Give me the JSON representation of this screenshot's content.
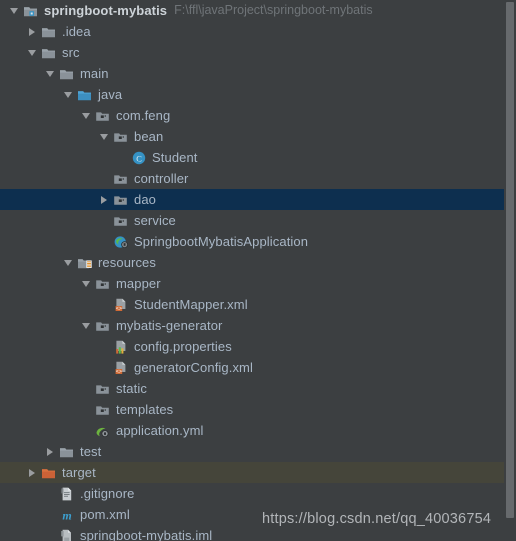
{
  "window": {
    "background": "#3c3f41",
    "selection_color": "#0d2f4f",
    "target_row_color": "#45453a",
    "text_color": "#a9b7c6"
  },
  "project": {
    "name": "springboot-mybatis",
    "path": "F:\\ffl\\javaProject\\springboot-mybatis"
  },
  "watermark": {
    "text": "https://blog.csdn.net/qq_40036754"
  },
  "tree": {
    "rows": [
      {
        "label": "springboot-mybatis",
        "suffix": "F:\\ffl\\javaProject\\springboot-mybatis",
        "indent": 0,
        "arrow": "expanded",
        "icon": "project-module-icon",
        "bold": true,
        "state": "normal"
      },
      {
        "label": ".idea",
        "indent": 1,
        "arrow": "collapsed",
        "icon": "folder-grey-icon",
        "bold": false,
        "state": "normal"
      },
      {
        "label": "src",
        "indent": 1,
        "arrow": "expanded",
        "icon": "folder-grey-icon",
        "bold": false,
        "state": "normal"
      },
      {
        "label": "main",
        "indent": 2,
        "arrow": "expanded",
        "icon": "folder-grey-icon",
        "bold": false,
        "state": "normal"
      },
      {
        "label": "java",
        "indent": 3,
        "arrow": "expanded",
        "icon": "folder-source-icon",
        "bold": false,
        "state": "normal"
      },
      {
        "label": "com.feng",
        "indent": 4,
        "arrow": "expanded",
        "icon": "folder-package-icon",
        "bold": false,
        "state": "normal"
      },
      {
        "label": "bean",
        "indent": 5,
        "arrow": "expanded",
        "icon": "folder-package-icon",
        "bold": false,
        "state": "normal"
      },
      {
        "label": "Student",
        "indent": 6,
        "arrow": "none",
        "icon": "java-class-icon",
        "bold": false,
        "state": "normal"
      },
      {
        "label": "controller",
        "indent": 5,
        "arrow": "none",
        "icon": "folder-package-icon",
        "bold": false,
        "state": "normal"
      },
      {
        "label": "dao",
        "indent": 5,
        "arrow": "collapsed",
        "icon": "folder-package-icon",
        "bold": false,
        "state": "selected"
      },
      {
        "label": "service",
        "indent": 5,
        "arrow": "none",
        "icon": "folder-package-icon",
        "bold": false,
        "state": "normal"
      },
      {
        "label": "SpringbootMybatisApplication",
        "indent": 5,
        "arrow": "none",
        "icon": "spring-boot-class-icon",
        "bold": false,
        "state": "normal"
      },
      {
        "label": "resources",
        "indent": 3,
        "arrow": "expanded",
        "icon": "folder-resources-icon",
        "bold": false,
        "state": "normal"
      },
      {
        "label": "mapper",
        "indent": 4,
        "arrow": "expanded",
        "icon": "folder-package-icon",
        "bold": false,
        "state": "normal"
      },
      {
        "label": "StudentMapper.xml",
        "indent": 5,
        "arrow": "none",
        "icon": "xml-file-icon",
        "bold": false,
        "state": "normal"
      },
      {
        "label": "mybatis-generator",
        "indent": 4,
        "arrow": "expanded",
        "icon": "folder-package-icon",
        "bold": false,
        "state": "normal"
      },
      {
        "label": "config.properties",
        "indent": 5,
        "arrow": "none",
        "icon": "properties-file-icon",
        "bold": false,
        "state": "normal"
      },
      {
        "label": "generatorConfig.xml",
        "indent": 5,
        "arrow": "none",
        "icon": "xml-file-icon",
        "bold": false,
        "state": "normal"
      },
      {
        "label": "static",
        "indent": 4,
        "arrow": "none",
        "icon": "folder-package-icon",
        "bold": false,
        "state": "normal"
      },
      {
        "label": "templates",
        "indent": 4,
        "arrow": "none",
        "icon": "folder-package-icon",
        "bold": false,
        "state": "normal"
      },
      {
        "label": "application.yml",
        "indent": 4,
        "arrow": "none",
        "icon": "spring-yaml-icon",
        "bold": false,
        "state": "normal"
      },
      {
        "label": "test",
        "indent": 2,
        "arrow": "collapsed",
        "icon": "folder-grey-icon",
        "bold": false,
        "state": "normal"
      },
      {
        "label": "target",
        "indent": 1,
        "arrow": "collapsed",
        "icon": "folder-orange-icon",
        "bold": false,
        "state": "target"
      },
      {
        "label": ".gitignore",
        "indent": 2,
        "arrow": "none",
        "icon": "text-file-icon",
        "bold": false,
        "state": "normal"
      },
      {
        "label": "pom.xml",
        "indent": 2,
        "arrow": "none",
        "icon": "maven-file-icon",
        "bold": false,
        "state": "normal"
      },
      {
        "label": "springboot-mybatis.iml",
        "indent": 2,
        "arrow": "none",
        "icon": "iml-file-icon",
        "bold": false,
        "state": "normal"
      }
    ]
  }
}
